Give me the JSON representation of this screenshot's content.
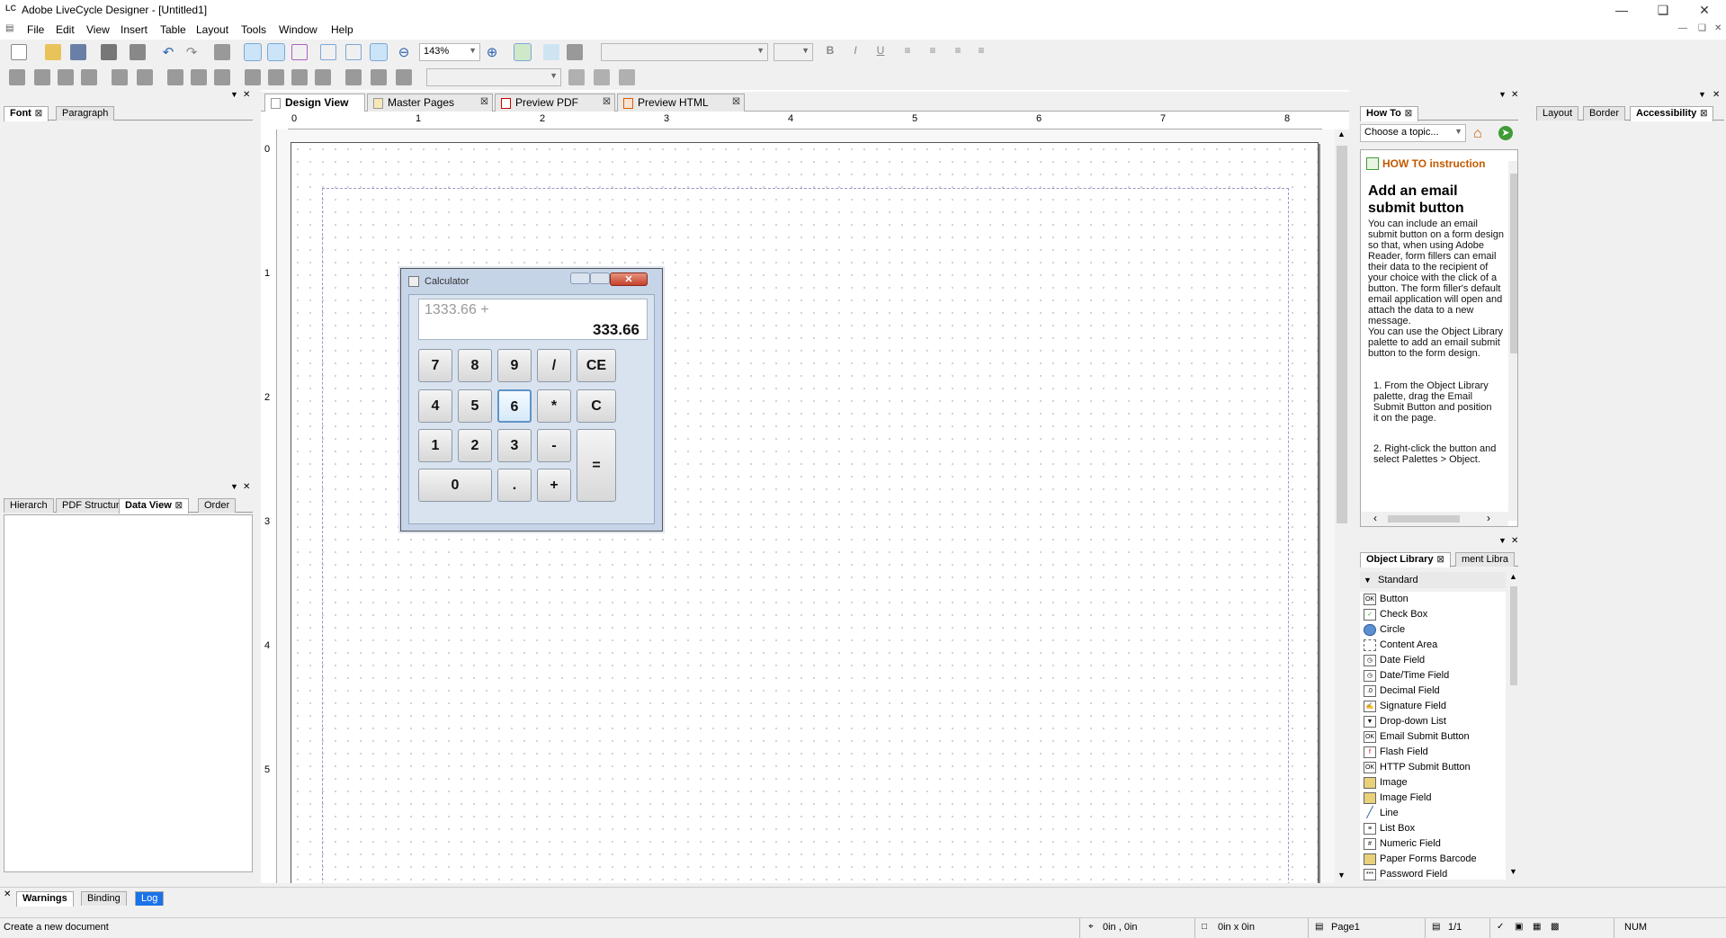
{
  "window": {
    "title": "Adobe LiveCycle Designer - [Untitled1]",
    "logo": "LC"
  },
  "menu": [
    "File",
    "Edit",
    "View",
    "Insert",
    "Table",
    "Layout",
    "Tools",
    "Window",
    "Help"
  ],
  "toolbar": {
    "zoom": "143%"
  },
  "left_top": {
    "tabs": [
      "Font",
      "Paragraph"
    ]
  },
  "left_bottom": {
    "tabs": [
      "Hierarch",
      "PDF Structur",
      "Data View",
      "Order"
    ]
  },
  "doc_tabs": [
    "Design View",
    "Master Pages",
    "Preview PDF",
    "Preview HTML"
  ],
  "ruler": {
    "h": [
      "0",
      "1",
      "2",
      "3",
      "4",
      "5",
      "6",
      "7",
      "8"
    ],
    "v": [
      "0",
      "1",
      "2",
      "3",
      "4",
      "5"
    ]
  },
  "calculator": {
    "title": "Calculator",
    "history": "1333.66 +",
    "display": "333.66",
    "keys": [
      "7",
      "8",
      "9",
      "/",
      "CE",
      "4",
      "5",
      "6",
      "*",
      "C",
      "1",
      "2",
      "3",
      "-",
      "=",
      "0",
      ".",
      "+"
    ]
  },
  "howto": {
    "tab": "How To",
    "select_placeholder": "Choose a topic...",
    "banner": "HOW TO instruction",
    "heading": "Add an email submit button",
    "para1": "You can include an email submit button on a form design so that, when using Adobe Reader, form fillers can email their data to the recipient of your choice with the click of a button. The form filler's default email application will open and attach the data to a new message.",
    "para2": "You can use the Object Library palette to add an email submit button to the form design.",
    "step1": "1. From the Object Library palette, drag the Email Submit Button and position it on the page.",
    "step2": "2. Right-click the button and select Palettes > Object."
  },
  "objlib": {
    "tabs": [
      "Object Library",
      "ment Libra"
    ],
    "group": "Standard",
    "items": [
      "Button",
      "Check Box",
      "Circle",
      "Content Area",
      "Date Field",
      "Date/Time Field",
      "Decimal Field",
      "Signature Field",
      "Drop-down List",
      "Email Submit Button",
      "Flash Field",
      "HTTP Submit Button",
      "Image",
      "Image Field",
      "Line",
      "List Box",
      "Numeric Field",
      "Paper Forms Barcode",
      "Password Field"
    ]
  },
  "farright": {
    "tabs": [
      "Layout",
      "Border",
      "Accessibility"
    ]
  },
  "bottom_tabs": [
    "Warnings",
    "Binding",
    "Log"
  ],
  "status": {
    "message": "Create a new document",
    "pos": "0in , 0in",
    "size": "0in x 0in",
    "page": "Page1",
    "pages": "1/1",
    "num": "NUM"
  }
}
